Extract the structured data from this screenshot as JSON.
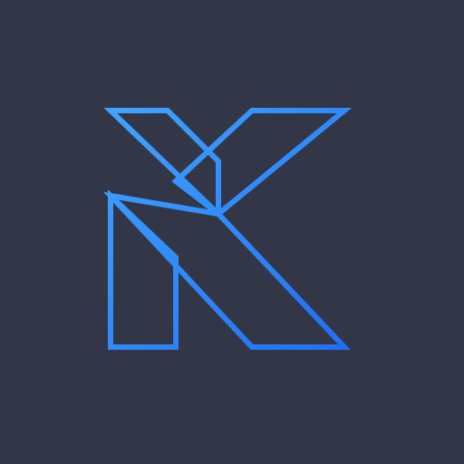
{
  "background_color": "#333646",
  "logo": {
    "icon": "letter-k-logo-icon",
    "gradient_start_color": "#40a4ff",
    "gradient_end_color": "#1f6ff5"
  }
}
